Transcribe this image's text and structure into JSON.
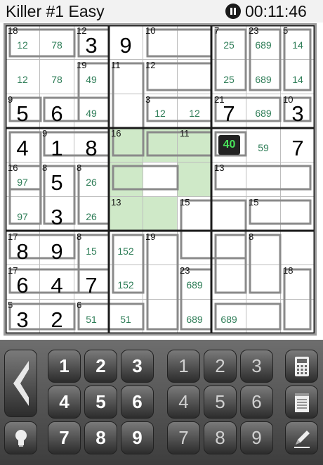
{
  "header": {
    "title": "Killer #1 Easy",
    "timer": "00:11:46"
  },
  "board": {
    "highlight_cells": [
      [
        3,
        3
      ],
      [
        3,
        4
      ],
      [
        3,
        5
      ],
      [
        4,
        3
      ],
      [
        4,
        5
      ],
      [
        5,
        3
      ],
      [
        5,
        4
      ]
    ],
    "selected_cell": {
      "row": 3,
      "col": 6,
      "label": "40"
    },
    "cages": [
      [
        0,
        0,
        18
      ],
      [
        0,
        2,
        12
      ],
      [
        0,
        4,
        10
      ],
      [
        0,
        6,
        7
      ],
      [
        0,
        7,
        23
      ],
      [
        0,
        8,
        5
      ],
      [
        1,
        2,
        19
      ],
      [
        1,
        3,
        11
      ],
      [
        1,
        4,
        12
      ],
      [
        2,
        0,
        9
      ],
      [
        2,
        4,
        3
      ],
      [
        2,
        6,
        21
      ],
      [
        2,
        8,
        10
      ],
      [
        3,
        1,
        9
      ],
      [
        3,
        3,
        16
      ],
      [
        3,
        5,
        11
      ],
      [
        4,
        0,
        16
      ],
      [
        4,
        1,
        8
      ],
      [
        4,
        2,
        8
      ],
      [
        4,
        6,
        13
      ],
      [
        5,
        3,
        13
      ],
      [
        5,
        5,
        15
      ],
      [
        5,
        7,
        15
      ],
      [
        6,
        0,
        17
      ],
      [
        6,
        2,
        8
      ],
      [
        6,
        4,
        19
      ],
      [
        6,
        7,
        8
      ],
      [
        7,
        0,
        17
      ],
      [
        7,
        5,
        23
      ],
      [
        7,
        8,
        18
      ],
      [
        8,
        0,
        5
      ],
      [
        8,
        2,
        6
      ]
    ],
    "values": [
      [
        0,
        2,
        "3"
      ],
      [
        0,
        3,
        "9"
      ],
      [
        2,
        0,
        "5"
      ],
      [
        2,
        1,
        "6"
      ],
      [
        2,
        6,
        "7"
      ],
      [
        2,
        8,
        "3"
      ],
      [
        3,
        0,
        "4"
      ],
      [
        3,
        1,
        "1"
      ],
      [
        3,
        2,
        "8"
      ],
      [
        3,
        8,
        "7"
      ],
      [
        4,
        1,
        "5"
      ],
      [
        5,
        1,
        "3"
      ],
      [
        6,
        0,
        "8"
      ],
      [
        6,
        1,
        "9"
      ],
      [
        7,
        0,
        "6"
      ],
      [
        7,
        1,
        "4"
      ],
      [
        7,
        2,
        "7"
      ],
      [
        8,
        0,
        "3"
      ],
      [
        8,
        1,
        "2"
      ]
    ],
    "candidates": [
      [
        0,
        0,
        "12"
      ],
      [
        0,
        1,
        "78"
      ],
      [
        0,
        6,
        "25"
      ],
      [
        0,
        7,
        "689"
      ],
      [
        0,
        8,
        "14"
      ],
      [
        1,
        0,
        "12"
      ],
      [
        1,
        1,
        "78"
      ],
      [
        1,
        2,
        "49"
      ],
      [
        1,
        6,
        "25"
      ],
      [
        1,
        7,
        "689"
      ],
      [
        1,
        8,
        "14"
      ],
      [
        2,
        2,
        "49"
      ],
      [
        2,
        4,
        "12"
      ],
      [
        2,
        5,
        "12"
      ],
      [
        2,
        7,
        "689"
      ],
      [
        3,
        7,
        "59"
      ],
      [
        4,
        0,
        "97"
      ],
      [
        4,
        2,
        "26"
      ],
      [
        5,
        0,
        "97"
      ],
      [
        5,
        2,
        "26"
      ],
      [
        6,
        2,
        "15"
      ],
      [
        6,
        3,
        "152"
      ],
      [
        7,
        3,
        "152"
      ],
      [
        7,
        5,
        "689"
      ],
      [
        8,
        2,
        "51"
      ],
      [
        8,
        3,
        "51"
      ],
      [
        8,
        5,
        "689"
      ],
      [
        8,
        6,
        "689"
      ]
    ]
  },
  "keypad": {
    "big_keys": [
      "1",
      "2",
      "3",
      "4",
      "5",
      "6",
      "7",
      "8",
      "9"
    ],
    "small_keys": [
      "1",
      "2",
      "3",
      "4",
      "5",
      "6",
      "7",
      "8",
      "9"
    ],
    "icons": {
      "back": "back-arrow-icon",
      "hint": "lightbulb-icon",
      "calculator": "calculator-icon",
      "notes": "notepad-icon",
      "pencil": "pencil-icon"
    }
  }
}
